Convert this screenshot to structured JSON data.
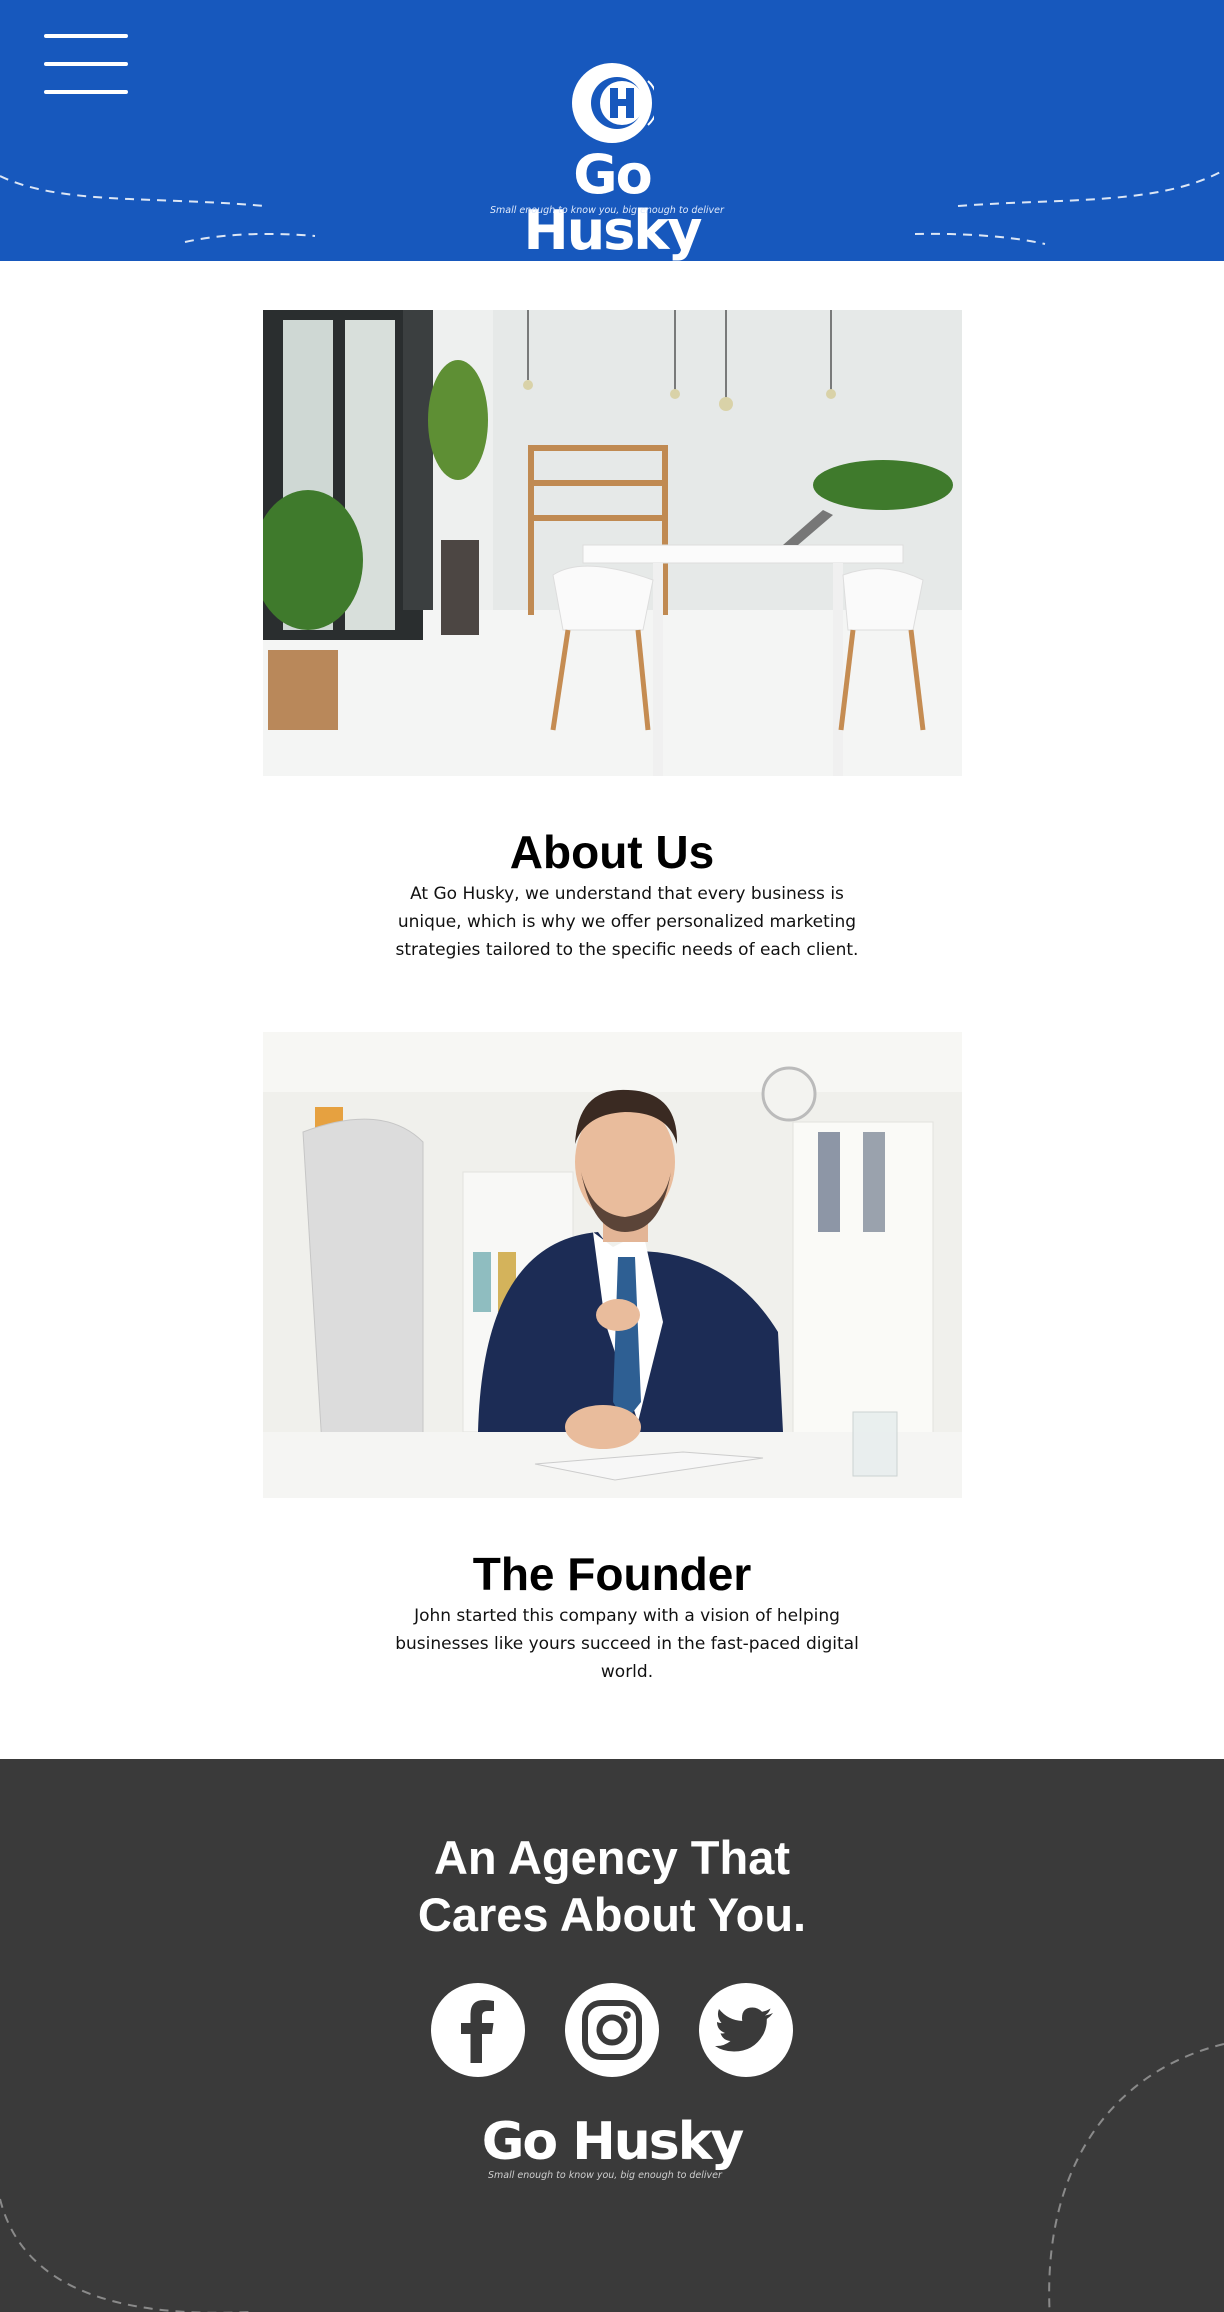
{
  "header": {
    "menu_icon": "hamburger-menu-icon",
    "logo": {
      "name": "Go Husky",
      "tagline": "Small enough to know you, big enough to deliver"
    },
    "background_color": "#1758bd"
  },
  "about": {
    "title": "About Us",
    "text": "At Go Husky, we understand that every business is unique, which is why we offer personalized marketing strategies tailored to the specific needs of each client."
  },
  "founder": {
    "title": "The Founder",
    "text": "John started this company with a vision of helping businesses like yours succeed in the fast-paced digital world."
  },
  "footer": {
    "heading_line1": "An Agency That",
    "heading_line2": "Cares About You.",
    "social": [
      {
        "icon": "facebook-icon"
      },
      {
        "icon": "instagram-icon"
      },
      {
        "icon": "twitter-icon"
      }
    ],
    "logo": {
      "name": "Go Husky",
      "tagline": "Small enough to know you, big enough to deliver"
    },
    "background_color": "#3a3a3a"
  }
}
